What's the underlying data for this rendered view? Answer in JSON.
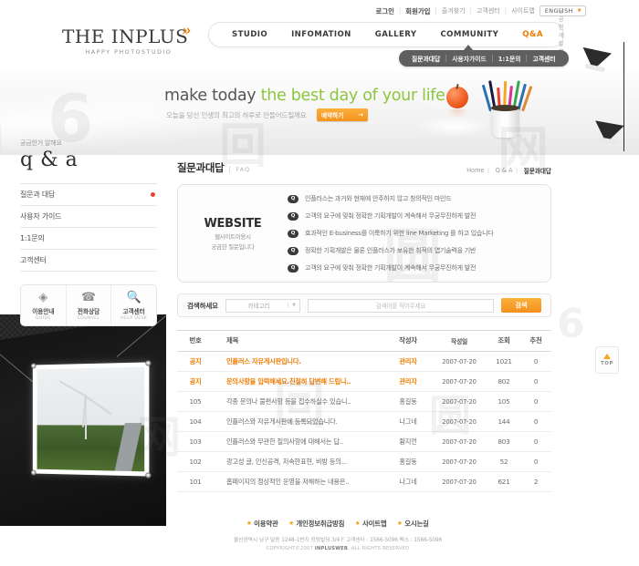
{
  "header": {
    "logo": {
      "main_a": "T",
      "main_b": "HE ",
      "text": "THE INPLUS",
      "tagline": "HAPPY PHOTOSTUDIO"
    },
    "util_nav": [
      {
        "label": "로그인",
        "strong": true
      },
      {
        "label": "회원가입",
        "strong": true
      },
      {
        "label": "즐겨찾기",
        "strong": false
      },
      {
        "label": "고객센터",
        "strong": false
      },
      {
        "label": "사이트맵",
        "strong": false
      }
    ],
    "language": "ENGLISH",
    "main_nav": [
      {
        "label": "STUDIO",
        "active": false
      },
      {
        "label": "INFOMATION",
        "active": false
      },
      {
        "label": "GALLERY",
        "active": false
      },
      {
        "label": "COMMUNITY",
        "active": false
      },
      {
        "label": "Q&A",
        "active": true
      }
    ],
    "nav_tag": "궁금한게 알해요",
    "sub_nav": [
      "질문과대답",
      "사용자가이드",
      "1:1문의",
      "고객센터"
    ]
  },
  "hero": {
    "title_a": "make today ",
    "title_b": "the best day of your life",
    "subtitle": "오늘을 당신 인생의 최고의 하루로 만들어드릴께요",
    "button": "예약하기",
    "button_arrow": "→"
  },
  "sidebar": {
    "eyebrow": "궁금한거 알해요",
    "title": "q & a",
    "items": [
      {
        "label": "질문과 대답",
        "active": true
      },
      {
        "label": "사용자 가이드",
        "active": false
      },
      {
        "label": "1:1문의",
        "active": false
      },
      {
        "label": "고객센터",
        "active": false
      }
    ],
    "quick": [
      {
        "icon": "guide-icon",
        "glyph": "◈",
        "label": "이용안내",
        "sub": "GUIDE"
      },
      {
        "icon": "telephone-icon",
        "glyph": "☎",
        "label": "전화상담",
        "sub": "COUNSEL"
      },
      {
        "icon": "magnifier-icon",
        "glyph": "🔍",
        "label": "고객센터",
        "sub": "HELP DESK"
      }
    ]
  },
  "content": {
    "page_title": "질문과대답",
    "page_title_en": "FAQ",
    "breadcrumb": {
      "home": "Home",
      "section": "Q & A",
      "current": "질문과대답",
      "sep": "〉"
    },
    "faq_box": {
      "heading": "WEBSITE",
      "line1": "웹사이트이용시",
      "line2": "궁금한 질문입니다",
      "badge": "Q",
      "items": [
        "인플러스는 과거와 현재에 안주하지 않고 창의적인 마인드",
        "고객의 요구에 맞춰 정확한 기획개발이 계속해서 무궁무진하게 발전",
        "효과적인 E-business를 이룩하기 위한 line Marketing 를 하고 있습니다",
        "정확한 기획개발은 물론 인플러스가 보유한 최적의 엽기술력을 기반",
        "고객의 요구에 맞춰 정확한 기획개발이 계속해서 무궁무진하게 발전"
      ]
    },
    "search": {
      "label": "검색하세요",
      "category": "카테고리",
      "placeholder": "검색어를 적어주세요",
      "button": "검색"
    },
    "table": {
      "headers": [
        "번호",
        "제목",
        "작성자",
        "작성일",
        "조회",
        "추천"
      ],
      "rows": [
        {
          "no": "공지",
          "notice": true,
          "title": "인플러스 자유게시판입니다.",
          "writer": "관리자",
          "date": "2007-07-20",
          "hit": "1021",
          "rec": "0"
        },
        {
          "no": "공지",
          "notice": true,
          "title": "문의사항을 입력해세요.친절히 답변해 드립니..",
          "writer": "관리자",
          "date": "2007-07-20",
          "hit": "802",
          "rec": "0"
        },
        {
          "no": "105",
          "notice": false,
          "title": "각종 문의나 불편사항 등을 접수하실수 있습니..",
          "writer": "홍길동",
          "date": "2007-07-20",
          "hit": "105",
          "rec": "0"
        },
        {
          "no": "104",
          "notice": false,
          "title": "인플러스와 자유게시판에 등록되었습니다.",
          "writer": "나그네",
          "date": "2007-07-20",
          "hit": "144",
          "rec": "0"
        },
        {
          "no": "103",
          "notice": false,
          "title": "인플러스와 무관한 질의사항에 대해서는 답..",
          "writer": "황지언",
          "date": "2007-07-20",
          "hit": "803",
          "rec": "0"
        },
        {
          "no": "102",
          "notice": false,
          "title": "광고성 글, 인신공격, 저속한표현, 비방 등의...",
          "writer": "홍길동",
          "date": "2007-07-20",
          "hit": "52",
          "rec": "0"
        },
        {
          "no": "101",
          "notice": false,
          "title": "홈페이지의 정상적인 운영을 저해하는 내용은..",
          "writer": "나그네",
          "date": "2007-07-20",
          "hit": "621",
          "rec": "2"
        }
      ]
    },
    "top_button": "TOP"
  },
  "footer": {
    "links": [
      "이용약관",
      "개인정보취급방침",
      "사이트맵",
      "오시는길"
    ],
    "address": "울산광역시 남구 달동 1248-1번지 정림빌딩 3/4 F 고객센터 : 1566-5096 팩스 : 1566-5096",
    "copyright_pre": "COPYRIGHT©2007 ",
    "copyright_brand": "INPLUSWEB",
    "copyright_post": ". ALL RIGHTS RESERVED"
  },
  "watermark": {
    "glyph1": "6",
    "glyph2": "回",
    "glyph3": "圆",
    "glyph4": "网"
  },
  "colors": {
    "accent": "#f07c00",
    "green": "#8cc63f",
    "dark": "#2e2e2e"
  }
}
